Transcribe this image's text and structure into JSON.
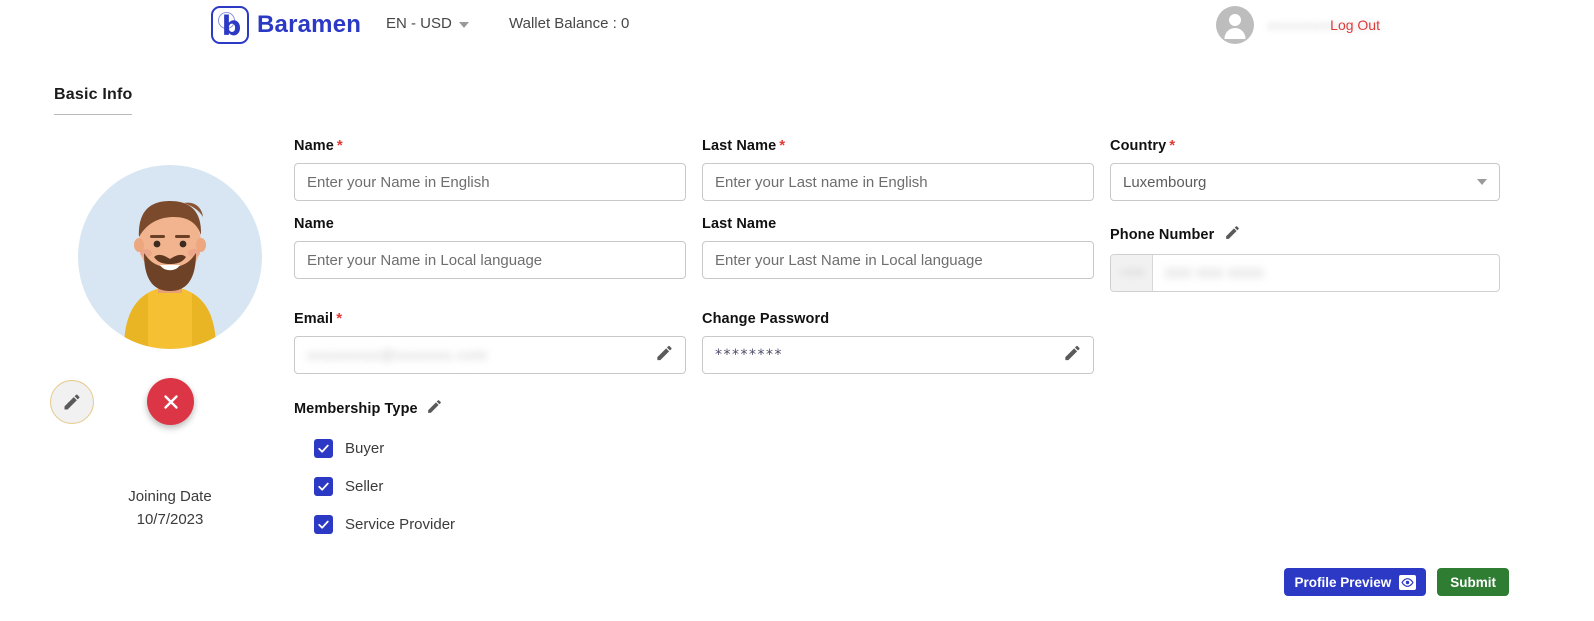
{
  "header": {
    "brand_name": "Baramen",
    "logo_letter": "b",
    "language": "EN - USD",
    "wallet": "Wallet Balance : 0",
    "username": "xxxxxxxxxxxxxxx",
    "logout": "Log Out"
  },
  "tabs": [
    {
      "label": "Basic Info",
      "active": true
    }
  ],
  "profile": {
    "joining_date_label": "Joining Date",
    "joining_date_value": "10/7/2023",
    "avatar_bg": "#d7e6f2",
    "shirt_color": "#f5c032",
    "hair_color": "#7b4a2c",
    "skin_color": "#f2b48e",
    "delete_color": "#dc3545"
  },
  "form": {
    "name_en": {
      "label": "Name",
      "required": true,
      "placeholder": "Enter your Name in English",
      "value": ""
    },
    "last_name_en": {
      "label": "Last Name",
      "required": true,
      "placeholder": "Enter your Last name in English",
      "value": ""
    },
    "country": {
      "label": "Country",
      "required": true,
      "value": "Luxembourg"
    },
    "name_local": {
      "label": "Name",
      "required": false,
      "placeholder": "Enter your Name in Local language",
      "value": ""
    },
    "last_name_local": {
      "label": "Last Name",
      "required": false,
      "placeholder": "Enter your Last Name in Local language",
      "value": ""
    },
    "phone": {
      "label": "Phone Number",
      "prefix": "+000",
      "value": "000 000 0000"
    },
    "email": {
      "label": "Email",
      "required": true,
      "value": "xxxxxxxxx@xxxxxxx.com"
    },
    "password": {
      "label": "Change Password",
      "value": "********"
    }
  },
  "membership": {
    "label": "Membership Type",
    "options": [
      {
        "label": "Buyer",
        "checked": true
      },
      {
        "label": "Seller",
        "checked": true
      },
      {
        "label": "Service Provider",
        "checked": true
      }
    ]
  },
  "footer": {
    "preview_label": "Profile Preview",
    "submit_label": "Submit",
    "preview_color": "#2b39c4",
    "submit_color": "#2e7d32"
  }
}
